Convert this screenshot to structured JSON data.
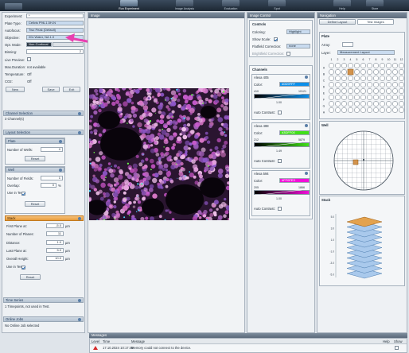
{
  "ribbon": {
    "items": [
      {
        "label": "Run Experiment"
      },
      {
        "label": "Image Analysis"
      },
      {
        "label": "Evaluation"
      },
      {
        "label": "Spot"
      },
      {
        "label": "Help"
      },
      {
        "label": "Store"
      }
    ]
  },
  "left": {
    "experiment": {
      "label": "Experiment:",
      "value": "*"
    },
    "plate_type": {
      "label": "Plate Type:",
      "value": "Cellvis P96-1.5H-N"
    },
    "autofocus": {
      "label": "Autofocus:",
      "value": "Two Peak (Default)"
    },
    "objective": {
      "label": "Objective:",
      "value": "20x Water, NA 1.0"
    },
    "opt_mode": {
      "label": "Opt. Mode:",
      "value": "Non-Confocal"
    },
    "binning": {
      "label": "Binning:",
      "value": "2"
    },
    "live_preview": {
      "label": "Live Preview:"
    },
    "max_duration": {
      "label": "Max.Duration:",
      "value": "not available"
    },
    "temperature": {
      "label": "Temperature:",
      "value": "Off"
    },
    "co2": {
      "label": "CO2:",
      "value": "Off"
    },
    "buttons": {
      "new": "New",
      "save": "Save",
      "exit": "Exit"
    },
    "channel_selection": {
      "title": "Channel Selection",
      "summary": "3 Channel(s)"
    },
    "layout_selection": {
      "title": "Layout Selection",
      "plate": {
        "title": "Plate",
        "wells_label": "Number of Wells:",
        "wells_value": "0",
        "reset": "Reset"
      },
      "well": {
        "title": "Well",
        "fields_label": "Number of Fields:",
        "fields_value": "1",
        "overlap_label": "Overlap:",
        "overlap_value": "0",
        "overlap_unit": "%",
        "use_in_test": "Use in Test:",
        "reset": "Reset"
      }
    },
    "stack": {
      "title": "Stack",
      "first_plane": {
        "label": "First Plane at:",
        "value": "-5.0",
        "unit": "µm"
      },
      "num_planes": {
        "label": "Number of Planes:",
        "value": "11"
      },
      "distance": {
        "label": "Distance:",
        "value": "1.0",
        "unit": "µm"
      },
      "last_plane": {
        "label": "Last Plane at:",
        "value": "5.0",
        "unit": "µm"
      },
      "overall_height": {
        "label": "Overall Height:",
        "value": "10.0",
        "unit": "µm"
      },
      "use_in_test": "Use in Test:",
      "reset": "Reset"
    },
    "time_series": {
      "title": "Time Series",
      "summary": "1 Timepoints, not used in Test."
    },
    "online_jobs": {
      "title": "Online Jobs",
      "summary": "No Online Job selected"
    }
  },
  "image": {
    "tab": "Image"
  },
  "image_control": {
    "tab": "Image Control",
    "controls": {
      "title": "Controls",
      "coloring_label": "Coloring:",
      "coloring_value": "Highlight",
      "show_scale_label": "Show Scale:",
      "flatfield_label": "Flatfield Correction:",
      "flatfield_value": "none",
      "brightfield_label": "Brightfield Correction:"
    },
    "channels": {
      "title": "Channels",
      "list": [
        {
          "name": "Alexa 405",
          "color_label": "Color:",
          "color_value": "#0D9FFF",
          "color_hex": "#0d8fe9",
          "min": "410",
          "max": "10121",
          "gamma": "1.00",
          "auto": "Auto Contrast:"
        },
        {
          "name": "Alexa 488",
          "color_label": "Color:",
          "color_value": "#3DFF00",
          "color_hex": "#41e01a",
          "min": "212",
          "max": "5879",
          "gamma": "1.49",
          "auto": "Auto Contrast:"
        },
        {
          "name": "Alexa 594",
          "color_label": "Color:",
          "color_value": "#FF0FE3",
          "color_hex": "#f20fd8",
          "min": "205",
          "max": "1866",
          "gamma": "1.00",
          "auto": "Auto Contrast:"
        }
      ]
    }
  },
  "navigation": {
    "tab": "Navigation",
    "subtabs": [
      "Define Layout",
      "Test Images"
    ],
    "plate": {
      "title": "Plate",
      "array_label": "Array:",
      "layer_label": "Layer:",
      "layer_value": "Measurement Layout",
      "col_headers": [
        "1",
        "2",
        "3",
        "4",
        "5",
        "6",
        "7",
        "8",
        "9",
        "10",
        "11",
        "12"
      ],
      "row_headers": [
        "A",
        "B",
        "C",
        "D",
        "E",
        "F",
        "G",
        "H"
      ]
    },
    "well_title": "Well",
    "stack": {
      "title": "Stack",
      "ticks": [
        "5.0",
        "3.0",
        "1.0",
        "-1.0",
        "-3.0",
        "-5.0"
      ]
    }
  },
  "messages": {
    "title": "Messages",
    "columns": [
      "Level",
      "Time",
      "Message",
      "Help",
      "Show"
    ],
    "rows": [
      {
        "time": "17.10.2024 10:17:46",
        "message": "Memory could not connect to the device."
      }
    ]
  }
}
